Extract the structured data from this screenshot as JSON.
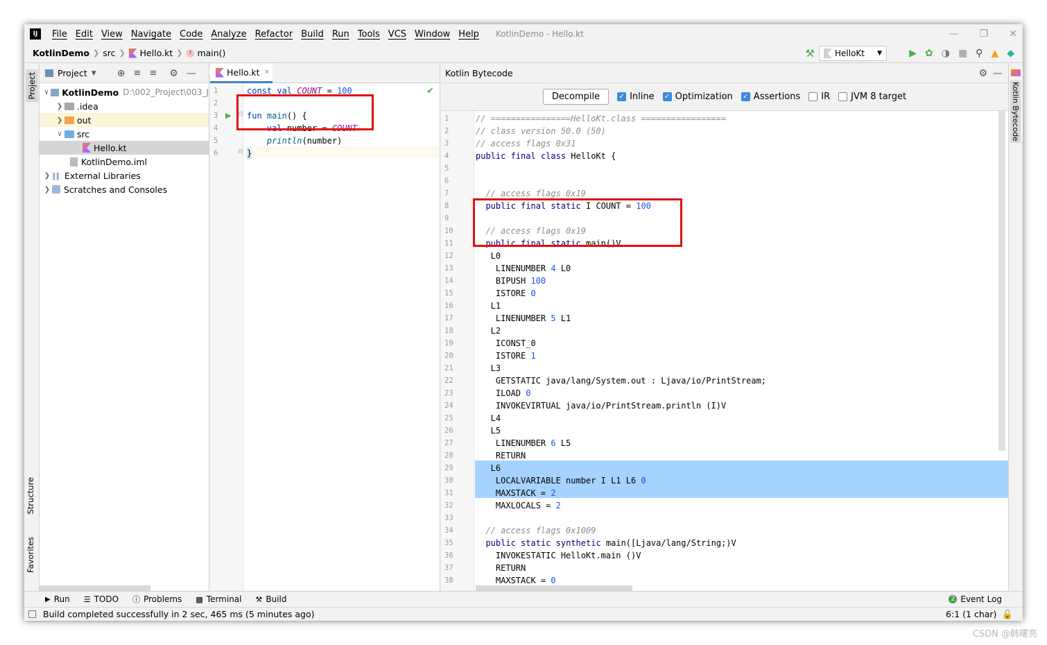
{
  "menu": [
    "File",
    "Edit",
    "View",
    "Navigate",
    "Code",
    "Analyze",
    "Refactor",
    "Build",
    "Run",
    "Tools",
    "VCS",
    "Window",
    "Help"
  ],
  "window_title": "KotlinDemo - Hello.kt",
  "breadcrumb": {
    "project": "KotlinDemo",
    "dir": "src",
    "file": "Hello.kt",
    "func": "main()"
  },
  "run_config": "HelloKt",
  "left_tabs": {
    "project": "Project",
    "structure": "Structure",
    "favorites": "Favorites"
  },
  "right_tabs": {
    "bytecode": "Kotlin Bytecode"
  },
  "project_panel": {
    "title": "Project",
    "tree": [
      {
        "label": "KotlinDemo",
        "hint": "D:\\002_Project\\003_J",
        "depth": 0,
        "expanded": true,
        "bold": true
      },
      {
        "label": ".idea",
        "depth": 1,
        "expanded": false
      },
      {
        "label": "out",
        "depth": 1,
        "expanded": false
      },
      {
        "label": "src",
        "depth": 1,
        "expanded": true
      },
      {
        "label": "Hello.kt",
        "depth": 2,
        "selected": true
      },
      {
        "label": "KotlinDemo.iml",
        "depth": 1
      },
      {
        "label": "External Libraries",
        "depth": 0,
        "expanded": false
      },
      {
        "label": "Scratches and Consoles",
        "depth": 0,
        "expanded": false
      }
    ]
  },
  "editor": {
    "tab": "Hello.kt",
    "line_numbers": [
      "1",
      "2",
      "3",
      "4",
      "5",
      "6"
    ],
    "code": {
      "l1": {
        "kw": "const val ",
        "const": "COUNT",
        "op": " = ",
        "num": "100"
      },
      "l3": {
        "kw": "fun ",
        "fn": "main",
        "rest": "() {"
      },
      "l4": {
        "kw": "    val ",
        "rest": "number = ",
        "const": "COUNT"
      },
      "l5": {
        "fn": "    println",
        "rest": "(number)"
      },
      "l6": {
        "rest": "}"
      }
    }
  },
  "bytecode_panel": {
    "title": "Kotlin Bytecode",
    "decompile": "Decompile",
    "options": [
      {
        "label": "Inline",
        "checked": true
      },
      {
        "label": "Optimization",
        "checked": true
      },
      {
        "label": "Assertions",
        "checked": true
      },
      {
        "label": "IR",
        "checked": false
      },
      {
        "label": "JVM 8 target",
        "checked": false
      }
    ],
    "lines": [
      "// ================HelloKt.class =================",
      "// class version 50.0 (50)",
      "// access flags 0x31",
      "public final class HelloKt {",
      "",
      "",
      "  // access flags 0x19",
      "  public final static I COUNT = 100",
      "",
      "  // access flags 0x19",
      "  public final static main()V",
      "   L0",
      "    LINENUMBER 4 L0",
      "    BIPUSH 100",
      "    ISTORE 0",
      "   L1",
      "    LINENUMBER 5 L1",
      "   L2",
      "    ICONST_0",
      "    ISTORE 1",
      "   L3",
      "    GETSTATIC java/lang/System.out : Ljava/io/PrintStream;",
      "    ILOAD 0",
      "    INVOKEVIRTUAL java/io/PrintStream.println (I)V",
      "   L4",
      "   L5",
      "    LINENUMBER 6 L5",
      "    RETURN",
      "   L6",
      "    LOCALVARIABLE number I L1 L6 0",
      "    MAXSTACK = 2",
      "    MAXLOCALS = 2",
      "",
      "  // access flags 0x1009",
      "  public static synthetic main([Ljava/lang/String;)V",
      "    INVOKESTATIC HelloKt.main ()V",
      "    RETURN",
      "    MAXSTACK = 0"
    ]
  },
  "bottom_tabs": [
    "Run",
    "TODO",
    "Problems",
    "Terminal",
    "Build"
  ],
  "event_log": {
    "badge": "2",
    "label": "Event Log"
  },
  "status": {
    "message": "Build completed successfully in 2 sec, 465 ms (5 minutes ago)",
    "position": "6:1 (1 char)"
  },
  "watermark": "CSDN @韩曙亮"
}
